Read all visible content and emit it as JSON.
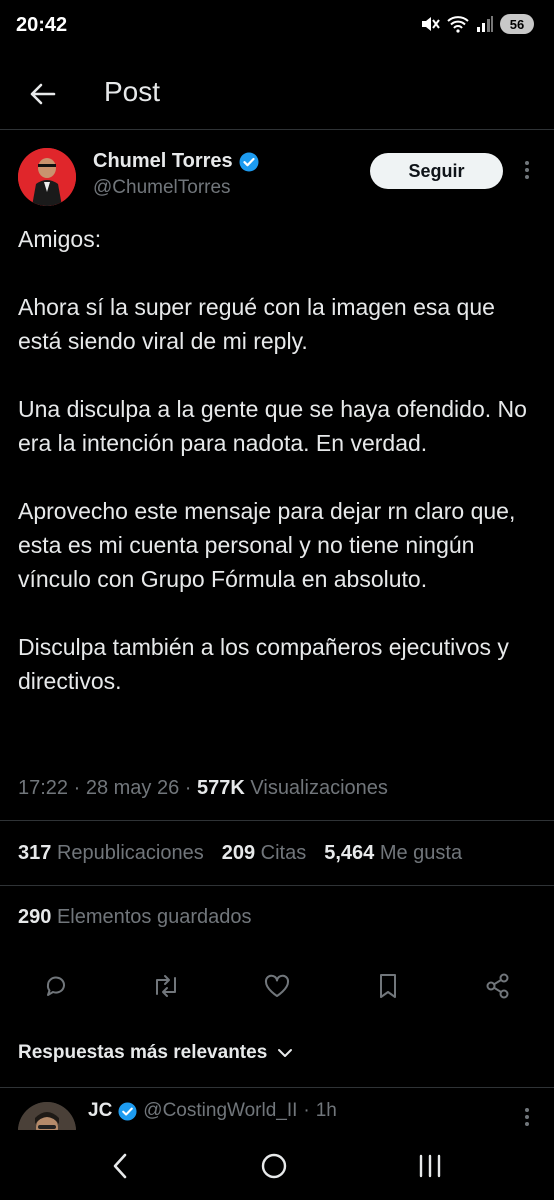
{
  "status_bar": {
    "time": "20:42",
    "battery": "56",
    "icons": [
      "mute-icon",
      "wifi-icon",
      "signal-icon",
      "battery-icon"
    ]
  },
  "header": {
    "title": "Post"
  },
  "tweet": {
    "author_name": "Chumel Torres",
    "author_handle": "@ChumelTorres",
    "verified": true,
    "follow_label": "Seguir",
    "paragraphs": [
      "Amigos:",
      "Ahora sí la super regué con la imagen esa que está siendo viral de mi reply.",
      "Una disculpa a la gente que se haya ofendido. No era la intención para nadota. En verdad.",
      "Aprovecho este mensaje para dejar rn claro que, esta es mi cuenta personal y no tiene ningún vínculo con Grupo Fórmula en absoluto.",
      "Disculpa también a los compañeros ejecutivos y directivos."
    ],
    "time": "17:22",
    "date": "28 may 26",
    "views_count": "577K",
    "views_label": "Visualizaciones",
    "stats": {
      "reposts_count": "317",
      "reposts_label": "Republicaciones",
      "quotes_count": "209",
      "quotes_label": "Citas",
      "likes_count": "5,464",
      "likes_label": "Me gusta",
      "bookmarks_count": "290",
      "bookmarks_label": "Elementos guardados"
    }
  },
  "replies": {
    "sort_label": "Respuestas más relevantes",
    "first_reply": {
      "name": "JC",
      "handle": "@CostingWorld_II",
      "time": "1h"
    }
  },
  "colors": {
    "background": "#000000",
    "text": "#e7e9ea",
    "muted": "#71767b",
    "verified": "#1d9bf0",
    "divider": "#2f3336"
  }
}
